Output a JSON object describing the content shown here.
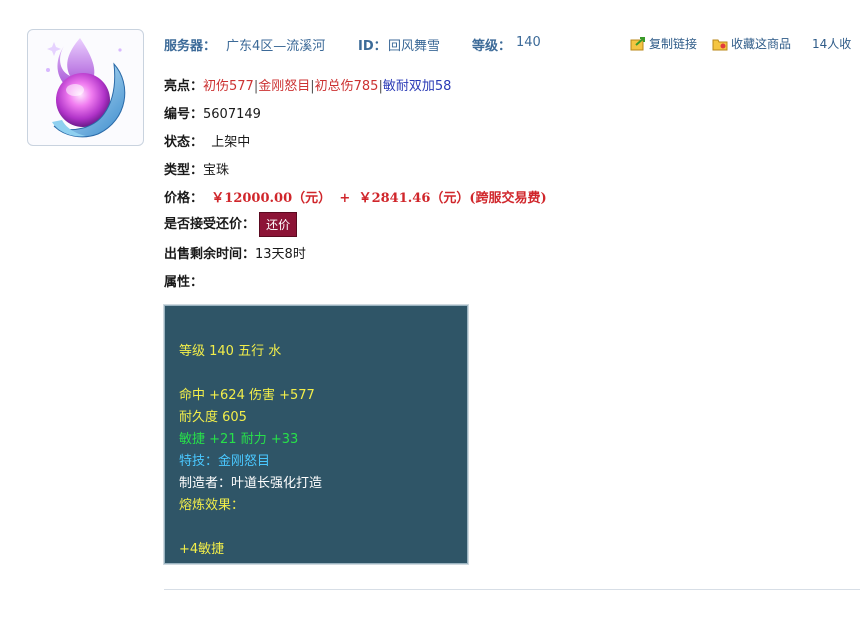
{
  "header": {
    "server_label": "服务器：",
    "server_value": "广东4区—流溪河",
    "id_label": "ID：",
    "id_value": "回风舞雪",
    "level_label": "等级：",
    "level_value": "140",
    "copy_link": "复制链接",
    "favorite": "收藏这商品",
    "favorite_count": "14人收"
  },
  "fields": {
    "highlights_label": "亮点：",
    "highlights": [
      "初伤577",
      "金刚怒目",
      "初总伤785",
      "敏耐双加58"
    ],
    "sep": "|",
    "number_label": "编号：",
    "number_value": "5607149",
    "status_label": "状态：",
    "status_value": "上架中",
    "type_label": "类型：",
    "type_value": "宝珠",
    "price_label": "价格：",
    "price_main": "￥12000.00（元）",
    "price_plus": "+",
    "price_fee": "￥2841.46（元）(跨服交易费)",
    "bargain_label": "是否接受还价：",
    "bargain_button": "还价",
    "time_left_label": "出售剩余时间：",
    "time_left_value": "13天8时",
    "attr_label": "属性："
  },
  "attributes": {
    "line_level": "等级 140 五行 水",
    "line_hit": "命中 +624 伤害 +577",
    "line_durability": "耐久度 605",
    "line_agility": "敏捷 +21 耐力 +33",
    "line_skill": "特技：金刚怒目",
    "line_maker": "制造者：叶道长强化打造",
    "line_refine": "熔炼效果：",
    "line_refine_value": "+4敏捷"
  },
  "colors": {
    "attr_bg": "#2f5567",
    "attr_yellow": "#f2ee4a",
    "attr_green": "#27e04a",
    "attr_cyan": "#4ac8ff",
    "price_red": "#d0262b",
    "button_bg": "#8c1436",
    "header_blue": "#3c6a98"
  },
  "icons": {
    "item_image": "pearl-orb-icon",
    "copy_link": "link-icon",
    "favorite": "folder-star-icon"
  }
}
